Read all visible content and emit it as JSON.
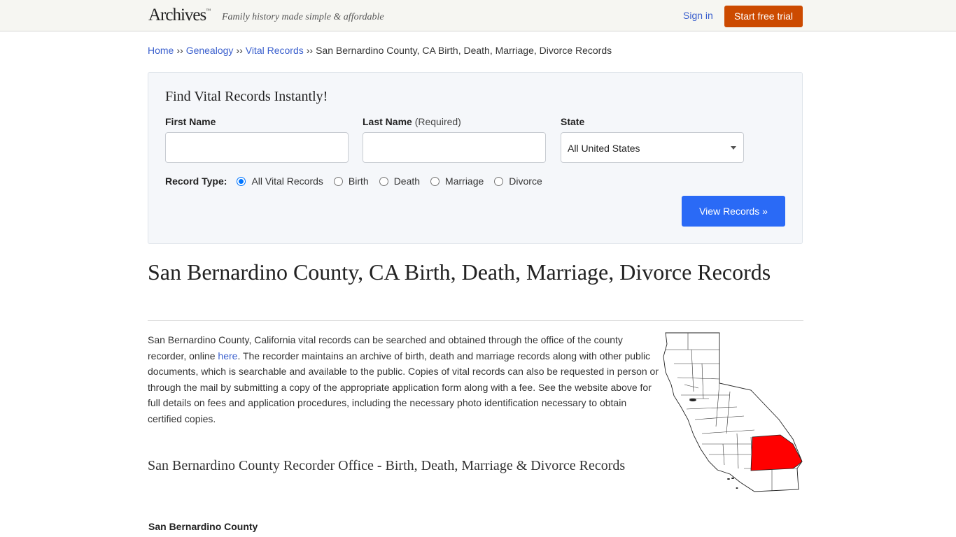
{
  "header": {
    "logo_text": "Archives",
    "logo_tm": "™",
    "tagline": "Family history made simple & affordable",
    "sign_in": "Sign in",
    "start_trial": "Start free trial"
  },
  "breadcrumb": {
    "items": [
      "Home",
      "Genealogy",
      "Vital Records"
    ],
    "separator": "››",
    "current": "San Bernardino County, CA Birth, Death, Marriage, Divorce Records"
  },
  "search": {
    "title": "Find Vital Records Instantly!",
    "first_name_label": "First Name",
    "first_name_value": "",
    "last_name_label": "Last Name",
    "last_name_req": "(Required)",
    "last_name_value": "",
    "state_label": "State",
    "state_value": "All United States",
    "record_type_label": "Record Type:",
    "record_types": [
      "All Vital Records",
      "Birth",
      "Death",
      "Marriage",
      "Divorce"
    ],
    "record_type_selected": "All Vital Records",
    "submit": "View Records »"
  },
  "main": {
    "title": "San Bernardino County, CA Birth, Death, Marriage, Divorce Records",
    "intro_pre": "San Bernardino County, California vital records can be searched and obtained through the office of the county recorder, online ",
    "intro_link": "here",
    "intro_post": ". The recorder maintains an archive of birth, death and marriage records along with other public documents, which is searchable and available to the public. Copies of vital records can also be requested in person or through the mail by submitting a copy of the appropriate application form along with a fee. See the website above for full details on fees and application procedures, including the necessary photo identification necessary to obtain certified copies.",
    "map_alt": "California county map with San Bernardino County highlighted",
    "highlight_color": "#ff0000",
    "subtitle": "San Bernardino County Recorder Office - Birth, Death, Marriage & Divorce Records",
    "county_name": "San Bernardino County"
  },
  "colors": {
    "trial_button": "#cc4a00",
    "primary_button": "#2a6af6",
    "link": "#3a5fcd"
  }
}
